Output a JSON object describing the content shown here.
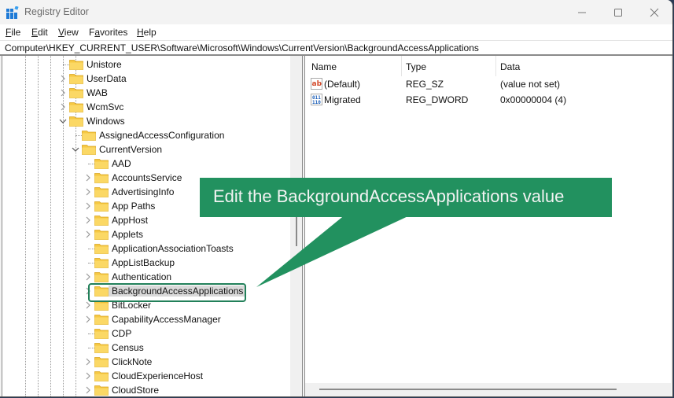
{
  "window": {
    "title": "Registry Editor",
    "controls": {
      "minimize": "—",
      "maximize": "☐",
      "close": "✕"
    }
  },
  "menu": {
    "items": [
      {
        "label_first": "F",
        "label_rest": "ile"
      },
      {
        "label_first": "E",
        "label_rest": "dit"
      },
      {
        "label_first": "V",
        "label_rest": "iew"
      },
      {
        "label_pre": "F",
        "label_first": "a",
        "label_rest": "vorites"
      },
      {
        "label_first": "H",
        "label_rest": "elp"
      }
    ]
  },
  "address": {
    "path": "Computer\\HKEY_CURRENT_USER\\Software\\Microsoft\\Windows\\CurrentVersion\\BackgroundAccessApplications"
  },
  "tree": {
    "items": [
      {
        "label": "Unistore",
        "level": 0,
        "expander": "none"
      },
      {
        "label": "UserData",
        "level": 0,
        "expander": "collapsed"
      },
      {
        "label": "WAB",
        "level": 0,
        "expander": "collapsed"
      },
      {
        "label": "WcmSvc",
        "level": 0,
        "expander": "collapsed"
      },
      {
        "label": "Windows",
        "level": 0,
        "expander": "expanded"
      },
      {
        "label": "AssignedAccessConfiguration",
        "level": 1,
        "expander": "none"
      },
      {
        "label": "CurrentVersion",
        "level": 1,
        "expander": "expanded"
      },
      {
        "label": "AAD",
        "level": 2,
        "expander": "none"
      },
      {
        "label": "AccountsService",
        "level": 2,
        "expander": "collapsed"
      },
      {
        "label": "AdvertisingInfo",
        "level": 2,
        "expander": "collapsed"
      },
      {
        "label": "App Paths",
        "level": 2,
        "expander": "collapsed"
      },
      {
        "label": "AppHost",
        "level": 2,
        "expander": "collapsed"
      },
      {
        "label": "Applets",
        "level": 2,
        "expander": "collapsed"
      },
      {
        "label": "ApplicationAssociationToasts",
        "level": 2,
        "expander": "none"
      },
      {
        "label": "AppListBackup",
        "level": 2,
        "expander": "none"
      },
      {
        "label": "Authentication",
        "level": 2,
        "expander": "collapsed"
      },
      {
        "label": "BackgroundAccessApplications",
        "level": 2,
        "expander": "collapsed",
        "selected": true
      },
      {
        "label": "BitLocker",
        "level": 2,
        "expander": "collapsed"
      },
      {
        "label": "CapabilityAccessManager",
        "level": 2,
        "expander": "collapsed"
      },
      {
        "label": "CDP",
        "level": 2,
        "expander": "none"
      },
      {
        "label": "Census",
        "level": 2,
        "expander": "none"
      },
      {
        "label": "ClickNote",
        "level": 2,
        "expander": "collapsed"
      },
      {
        "label": "CloudExperienceHost",
        "level": 2,
        "expander": "collapsed"
      },
      {
        "label": "CloudStore",
        "level": 2,
        "expander": "collapsed"
      }
    ]
  },
  "values": {
    "columns": [
      "Name",
      "Type",
      "Data"
    ],
    "rows": [
      {
        "icon": "string-value-icon",
        "name": "(Default)",
        "type": "REG_SZ",
        "data": "(value not set)"
      },
      {
        "icon": "binary-value-icon",
        "name": "Migrated",
        "type": "REG_DWORD",
        "data": "0x00000004 (4)"
      }
    ]
  },
  "callout": {
    "text": "Edit the BackgroundAccessApplications value",
    "color": "#22915f"
  },
  "colors": {
    "highlight_border": "#22805a",
    "folder": "#f6c842"
  }
}
